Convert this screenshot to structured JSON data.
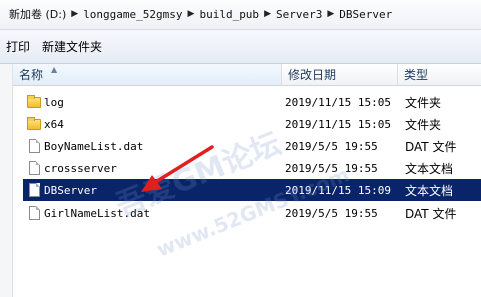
{
  "address": {
    "crumbs": [
      "新加卷 (D:)",
      "longgame_52gmsy",
      "build_pub",
      "Server3",
      "DBServer"
    ]
  },
  "toolbar": {
    "print_label": "打印",
    "new_folder_label": "新建文件夹"
  },
  "columns": {
    "name": "名称",
    "date": "修改日期",
    "type": "类型"
  },
  "files": [
    {
      "name": "log",
      "date": "2019/11/15 15:05",
      "type": "文件夹",
      "icon": "folder-icon"
    },
    {
      "name": "x64",
      "date": "2019/11/15 15:05",
      "type": "文件夹",
      "icon": "folder-icon"
    },
    {
      "name": "BoyNameList.dat",
      "date": "2019/5/5 19:55",
      "type": "DAT 文件",
      "icon": "file-icon"
    },
    {
      "name": "crossserver",
      "date": "2019/5/5 19:55",
      "type": "文本文档",
      "icon": "file-icon"
    },
    {
      "name": "DBServer",
      "date": "2019/11/15 15:09",
      "type": "文本文档",
      "icon": "file-icon",
      "selected": true
    },
    {
      "name": "GirlNameList.dat",
      "date": "2019/5/5 19:55",
      "type": "DAT 文件",
      "icon": "file-icon"
    }
  ],
  "watermark": {
    "main": "吾爱GM论坛",
    "url": "www.52GMSY.com"
  },
  "colors": {
    "selection": "#0a246a",
    "arrow": "#e02020"
  }
}
